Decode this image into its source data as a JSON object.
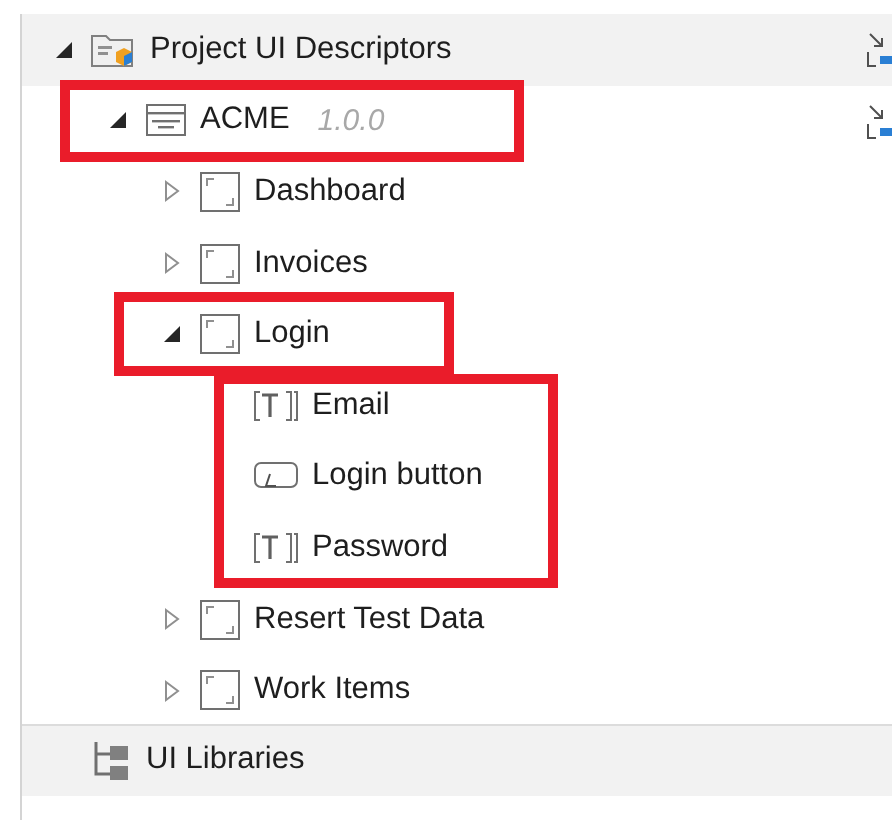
{
  "tree": {
    "items": [
      {
        "kind": "project",
        "label": "Project UI Descriptors",
        "expanded": true,
        "action_icon": true,
        "children": [
          {
            "kind": "library",
            "label": "ACME",
            "version": "1.0.0",
            "expanded": true,
            "highlighted": true,
            "action_icon": true,
            "children": [
              {
                "kind": "screen",
                "label": "Dashboard",
                "expanded": false,
                "highlighted": false
              },
              {
                "kind": "screen",
                "label": "Invoices",
                "expanded": false,
                "highlighted": false
              },
              {
                "kind": "screen",
                "label": "Login",
                "expanded": true,
                "highlighted": true,
                "children_highlighted": true,
                "children": [
                  {
                    "kind": "textbox",
                    "label": "Email"
                  },
                  {
                    "kind": "button",
                    "label": "Login button"
                  },
                  {
                    "kind": "textbox",
                    "label": "Password"
                  }
                ]
              },
              {
                "kind": "screen",
                "label": "Resert Test Data",
                "expanded": false,
                "highlighted": false
              },
              {
                "kind": "screen",
                "label": "Work Items",
                "expanded": false,
                "highlighted": false
              }
            ]
          }
        ]
      },
      {
        "kind": "libraries",
        "label": "UI Libraries"
      }
    ]
  }
}
